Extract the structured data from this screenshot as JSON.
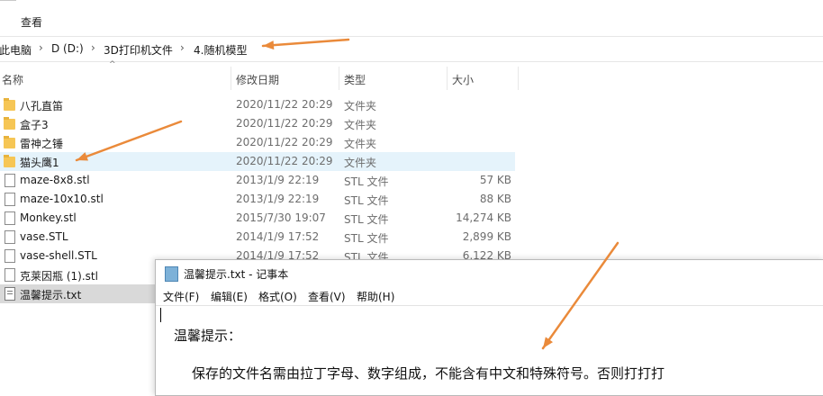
{
  "ribbon": {
    "view_tab": "查看"
  },
  "breadcrumb": [
    "此电脑",
    "D (D:)",
    "3D打印机文件",
    "4.随机模型"
  ],
  "breadcrumb_sep": "›",
  "columns": {
    "name": "名称",
    "date": "修改日期",
    "type": "类型",
    "size": "大小"
  },
  "files": [
    {
      "name": "八孔直笛",
      "date": "2020/11/22 20:29",
      "type": "文件夹",
      "size": "",
      "icon": "folder-icon"
    },
    {
      "name": "盒子3",
      "date": "2020/11/22 20:29",
      "type": "文件夹",
      "size": "",
      "icon": "folder-icon"
    },
    {
      "name": "雷神之锤",
      "date": "2020/11/22 20:29",
      "type": "文件夹",
      "size": "",
      "icon": "folder-icon"
    },
    {
      "name": "猫头鹰1",
      "date": "2020/11/22 20:29",
      "type": "文件夹",
      "size": "",
      "icon": "folder-icon"
    },
    {
      "name": "maze-8x8.stl",
      "date": "2013/1/9 22:19",
      "type": "STL 文件",
      "size": "57 KB",
      "icon": "file-icon"
    },
    {
      "name": "maze-10x10.stl",
      "date": "2013/1/9 22:19",
      "type": "STL 文件",
      "size": "88 KB",
      "icon": "file-icon"
    },
    {
      "name": "Monkey.stl",
      "date": "2015/7/30 19:07",
      "type": "STL 文件",
      "size": "14,274 KB",
      "icon": "file-icon"
    },
    {
      "name": "vase.STL",
      "date": "2014/1/9 17:52",
      "type": "STL 文件",
      "size": "2,899 KB",
      "icon": "file-icon"
    },
    {
      "name": "vase-shell.STL",
      "date": "2014/1/9 17:52",
      "type": "STL 文件",
      "size": "6,122 KB",
      "icon": "file-icon"
    },
    {
      "name": "克莱因瓶 (1).stl",
      "date": "",
      "type": "",
      "size": "",
      "icon": "file-icon"
    },
    {
      "name": "温馨提示.txt",
      "date": "",
      "type": "",
      "size": "",
      "icon": "text-file-icon"
    }
  ],
  "notepad": {
    "title": "温馨提示.txt - 记事本",
    "menu": [
      "文件(F)",
      "编辑(E)",
      "格式(O)",
      "查看(V)",
      "帮助(H)"
    ],
    "line1": "温馨提示：",
    "line2": "保存的文件名需由拉丁字母、数字组成，不能含有中文和特殊符号。否则打打打"
  },
  "colors": {
    "annotation_arrow": "#ea8a3a",
    "selection": "#e5f3fb",
    "folder": "#f6c655"
  }
}
